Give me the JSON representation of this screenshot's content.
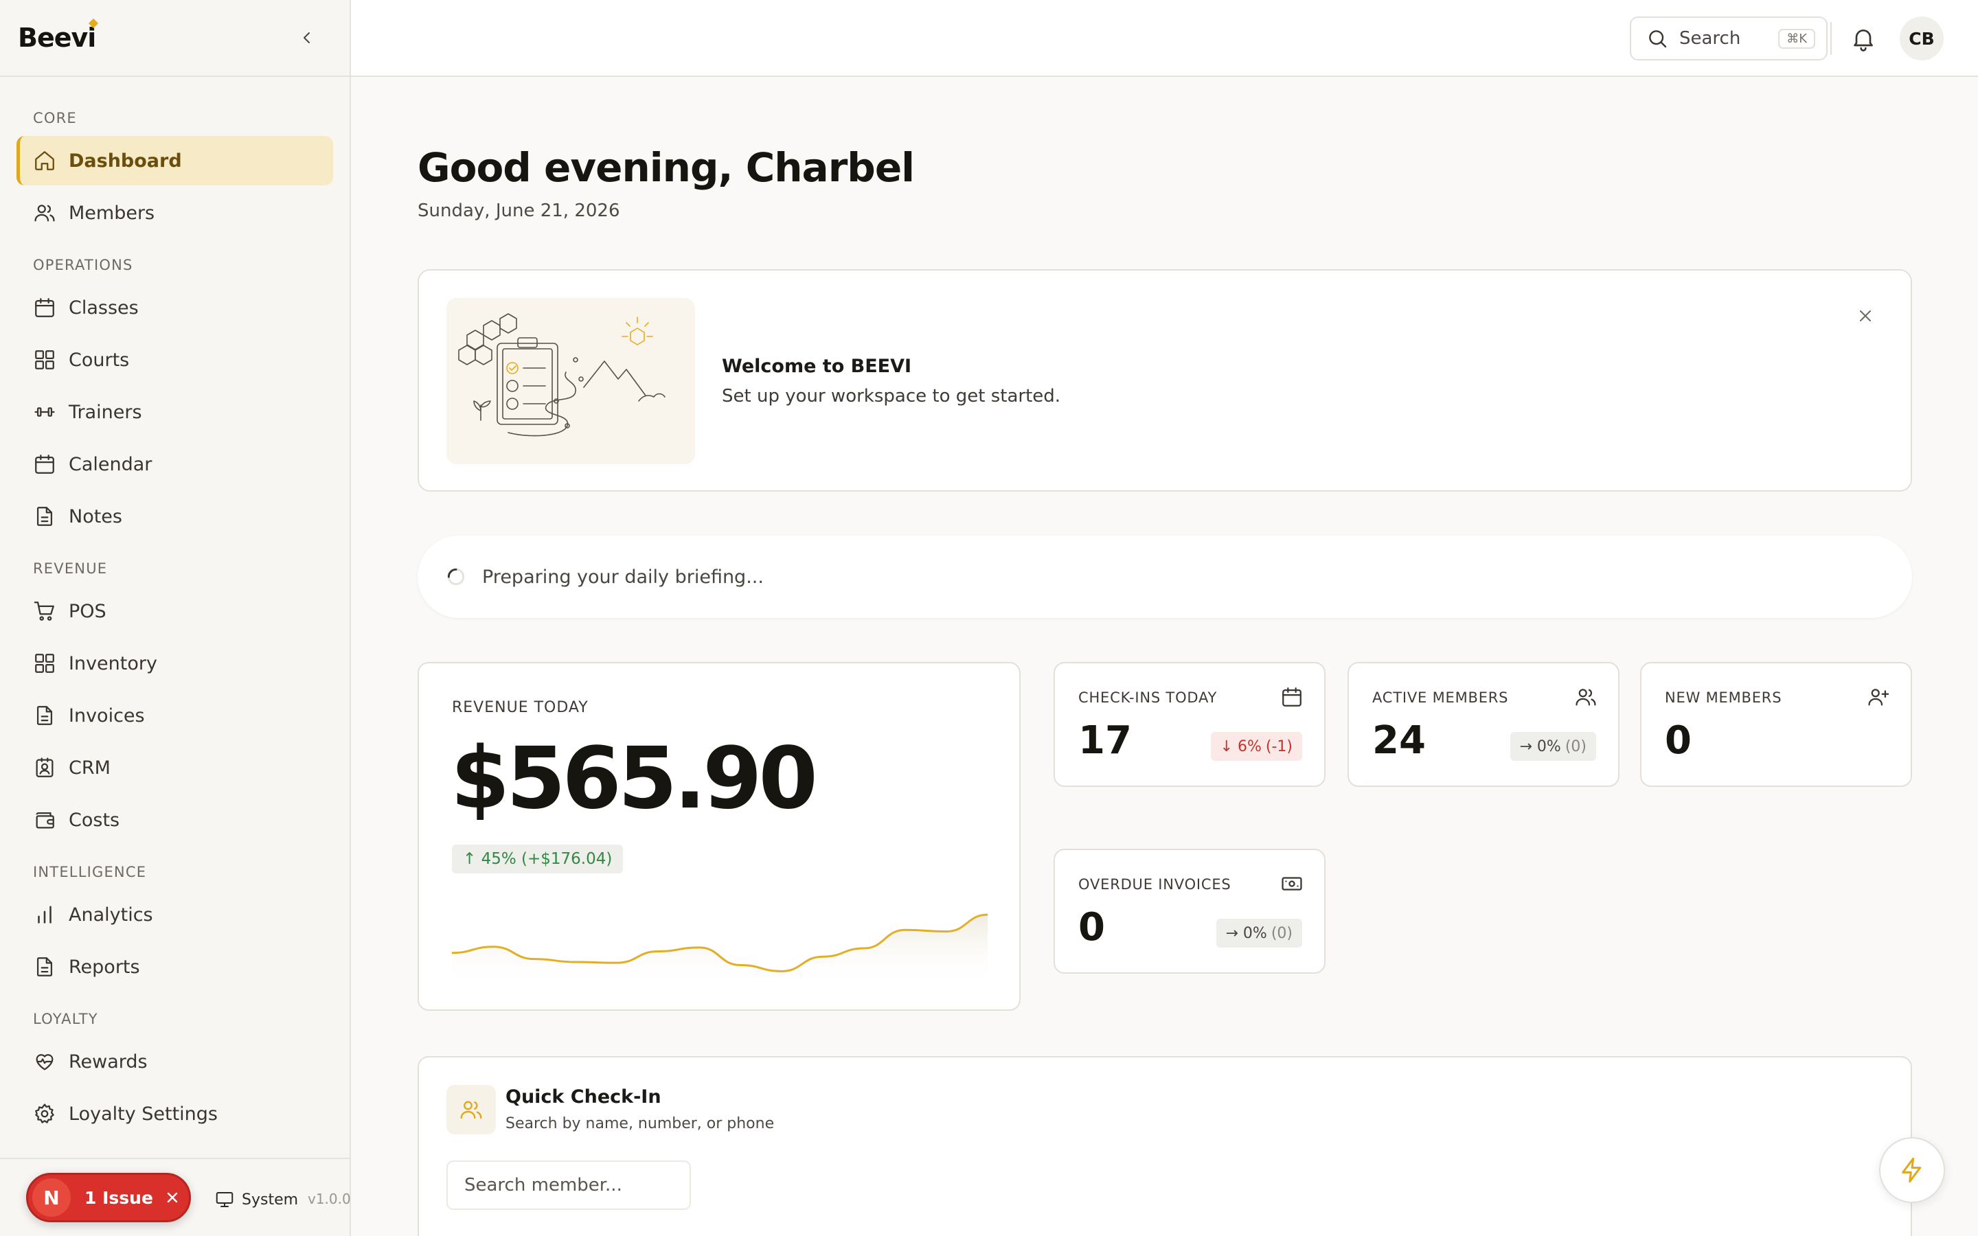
{
  "brand": {
    "logo_text": "Beevi"
  },
  "sidebar": {
    "sections": [
      {
        "label": "CORE",
        "items": [
          {
            "label": "Dashboard",
            "icon": "home-icon",
            "active": true
          },
          {
            "label": "Members",
            "icon": "users-icon"
          }
        ]
      },
      {
        "label": "OPERATIONS",
        "items": [
          {
            "label": "Classes",
            "icon": "calendar-icon"
          },
          {
            "label": "Courts",
            "icon": "grid-icon"
          },
          {
            "label": "Trainers",
            "icon": "dumbbell-icon"
          },
          {
            "label": "Calendar",
            "icon": "calendar-icon"
          },
          {
            "label": "Notes",
            "icon": "file-icon"
          }
        ]
      },
      {
        "label": "REVENUE",
        "items": [
          {
            "label": "POS",
            "icon": "cart-icon"
          },
          {
            "label": "Inventory",
            "icon": "grid-icon"
          },
          {
            "label": "Invoices",
            "icon": "file-icon"
          },
          {
            "label": "CRM",
            "icon": "contact-icon"
          },
          {
            "label": "Costs",
            "icon": "wallet-icon"
          }
        ]
      },
      {
        "label": "INTELLIGENCE",
        "items": [
          {
            "label": "Analytics",
            "icon": "bar-chart-icon"
          },
          {
            "label": "Reports",
            "icon": "file-icon"
          }
        ]
      },
      {
        "label": "LOYALTY",
        "items": [
          {
            "label": "Rewards",
            "icon": "heart-pulse-icon"
          },
          {
            "label": "Loyalty Settings",
            "icon": "gear-icon"
          }
        ]
      }
    ],
    "footer": {
      "issue_letter": "N",
      "issue_label": "1 Issue",
      "theme_label": "System",
      "version": "v1.0.0"
    }
  },
  "topbar": {
    "search_label": "Search",
    "search_shortcut": "⌘K",
    "avatar_initials": "CB"
  },
  "main": {
    "greeting": "Good evening, Charbel",
    "date": "Sunday, June 21, 2026",
    "welcome": {
      "title": "Welcome to BEEVI",
      "subtitle": "Set up your workspace to get started."
    },
    "briefing_text": "Preparing your daily briefing...",
    "revenue": {
      "label": "REVENUE TODAY",
      "value": "$565.90",
      "change": "↑ 45% (+$176.04)",
      "sparkline": [
        38,
        46,
        30,
        26,
        25,
        40,
        45,
        22,
        14,
        33,
        44,
        68,
        66,
        88
      ],
      "sparkline_color": "#e2ae26"
    },
    "stats": {
      "checkins": {
        "label": "CHECK-INS TODAY",
        "value": "17",
        "change": "↓ 6%",
        "change_detail": "(-1)"
      },
      "active_members": {
        "label": "ACTIVE MEMBERS",
        "value": "24",
        "change": "→ 0%",
        "change_detail": "(0)"
      },
      "new_members": {
        "label": "NEW MEMBERS",
        "value": "0"
      },
      "overdue_invoices": {
        "label": "OVERDUE INVOICES",
        "value": "0",
        "change": "→ 0%",
        "change_detail": "(0)"
      }
    },
    "quick_checkin": {
      "title": "Quick Check-In",
      "subtitle": "Search by name, number, or phone",
      "placeholder": "Search member..."
    }
  },
  "colors": {
    "accent": "#e0a91d",
    "danger": "#d9302b",
    "success": "#2f8a43"
  }
}
